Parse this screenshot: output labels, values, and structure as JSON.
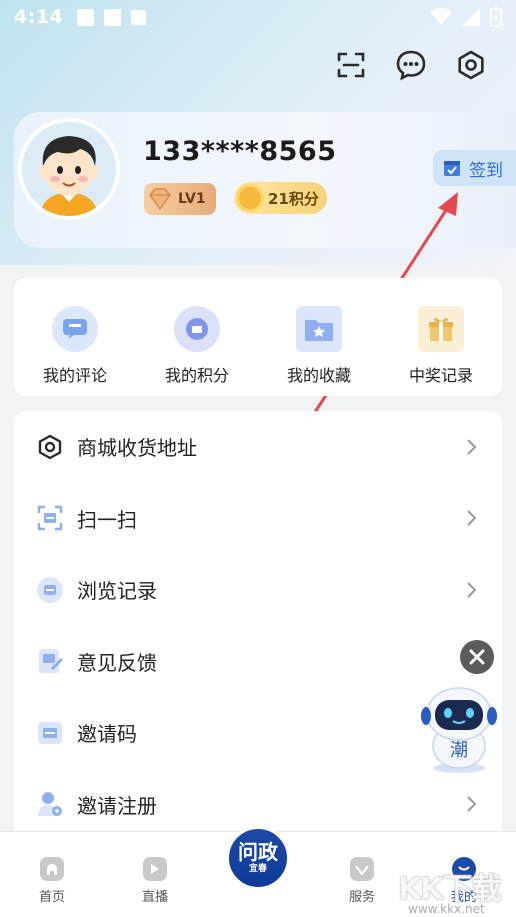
{
  "status_bar": {
    "time": "4:14"
  },
  "header_icons": [
    "scan-icon",
    "message-icon",
    "settings-icon"
  ],
  "profile": {
    "phone": "133****8565",
    "level": "LV1",
    "points": "21积分",
    "sign_in": "签到"
  },
  "quick_actions": [
    {
      "label": "我的评论",
      "icon": "comment-icon",
      "color": "#dbe7fb"
    },
    {
      "label": "我的积分",
      "icon": "points-icon",
      "color": "#dde0fb"
    },
    {
      "label": "我的收藏",
      "icon": "favorite-folder-icon",
      "color": "#dce6fb"
    },
    {
      "label": "中奖记录",
      "icon": "gift-icon",
      "color": "#fbf0d6"
    }
  ],
  "menu": [
    {
      "label": "商城收货地址",
      "icon": "hexagon-icon",
      "chevron": true
    },
    {
      "label": "扫一扫",
      "icon": "scan-icon",
      "chevron": true
    },
    {
      "label": "浏览记录",
      "icon": "history-icon",
      "chevron": true
    },
    {
      "label": "意见反馈",
      "icon": "feedback-icon",
      "chevron": false
    },
    {
      "label": "邀请码",
      "icon": "invite-code-icon",
      "chevron": false
    },
    {
      "label": "邀请注册",
      "icon": "invite-register-icon",
      "chevron": true
    }
  ],
  "tabs": [
    {
      "label": "首页",
      "icon": "home-icon"
    },
    {
      "label": "直播",
      "icon": "play-icon"
    },
    {
      "label": "问政",
      "icon": "center-logo"
    },
    {
      "label": "服务",
      "icon": "service-icon"
    },
    {
      "label": "我的",
      "icon": "profile-icon"
    }
  ],
  "center_logo_text": "问政",
  "center_logo_sub": "宜春",
  "robot_label": "潮",
  "watermark": {
    "text": "KK下载",
    "url": "www.kkx.net"
  },
  "colors": {
    "accent": "#2a6ed6",
    "tab_active": "#1c4aa8"
  }
}
